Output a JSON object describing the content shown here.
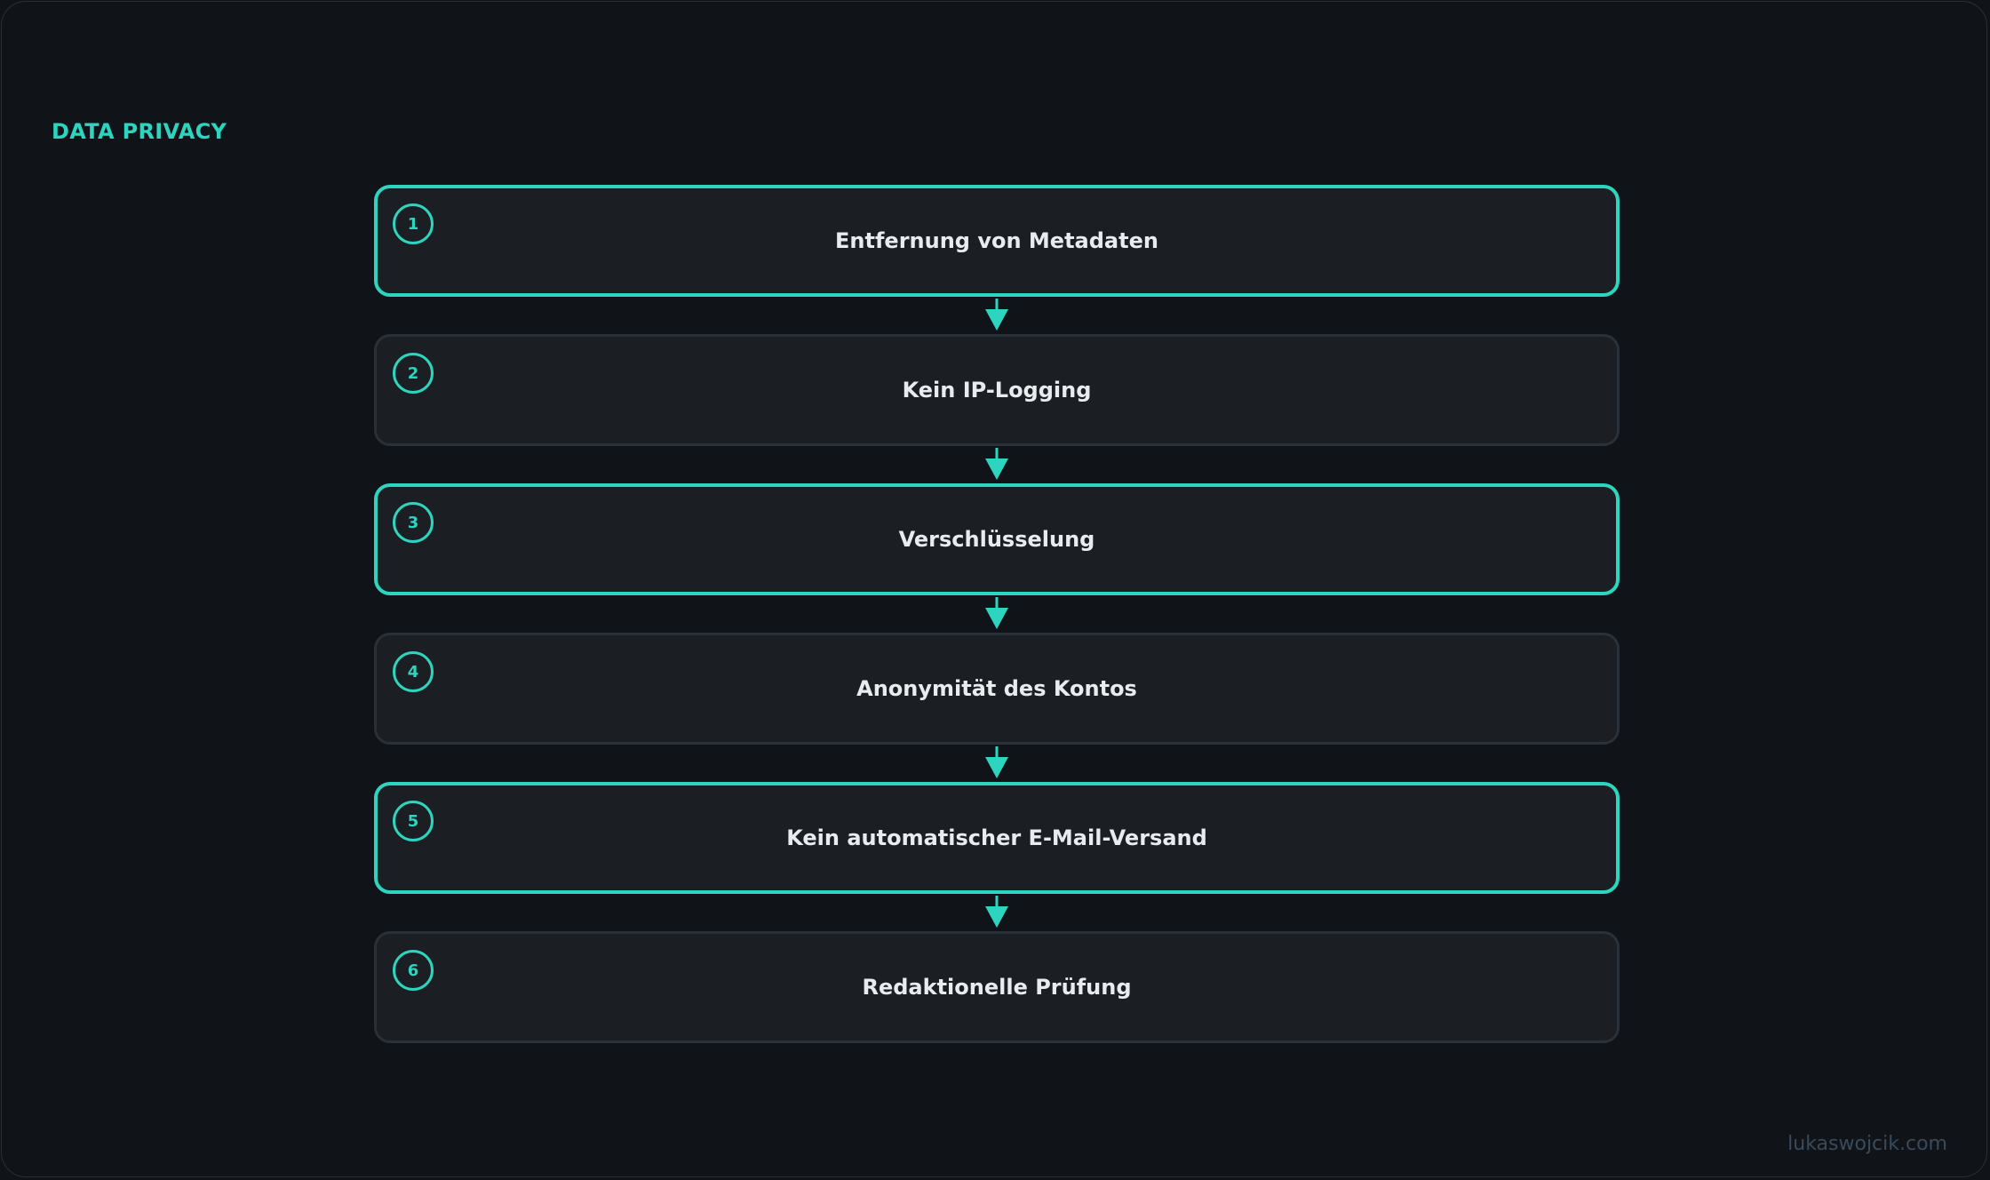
{
  "section_title": "DATA PRIVACY",
  "steps": [
    {
      "number": "1",
      "label": "Entfernung von Metadaten",
      "highlighted": true
    },
    {
      "number": "2",
      "label": "Kein IP-Logging",
      "highlighted": false
    },
    {
      "number": "3",
      "label": "Verschlüsselung",
      "highlighted": true
    },
    {
      "number": "4",
      "label": "Anonymität des Kontos",
      "highlighted": false
    },
    {
      "number": "5",
      "label": "Kein automatischer E-Mail-Versand",
      "highlighted": true
    },
    {
      "number": "6",
      "label": "Redaktionelle Prüfung",
      "highlighted": false
    }
  ],
  "footer": {
    "credit": "lukaswojcik.com"
  },
  "colors": {
    "accent": "#2dd4bf",
    "background": "#101418",
    "box": "#1b1f23",
    "box_border": "#2a3038",
    "text": "#e8ecef"
  }
}
